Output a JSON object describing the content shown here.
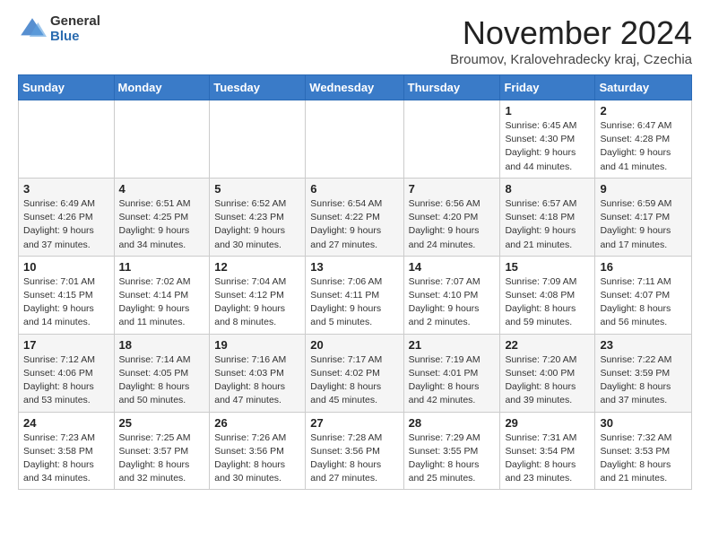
{
  "logo": {
    "general": "General",
    "blue": "Blue"
  },
  "title": "November 2024",
  "subtitle": "Broumov, Kralovehradecky kraj, Czechia",
  "days_header": [
    "Sunday",
    "Monday",
    "Tuesday",
    "Wednesday",
    "Thursday",
    "Friday",
    "Saturday"
  ],
  "weeks": [
    [
      {
        "day": "",
        "detail": ""
      },
      {
        "day": "",
        "detail": ""
      },
      {
        "day": "",
        "detail": ""
      },
      {
        "day": "",
        "detail": ""
      },
      {
        "day": "",
        "detail": ""
      },
      {
        "day": "1",
        "detail": "Sunrise: 6:45 AM\nSunset: 4:30 PM\nDaylight: 9 hours\nand 44 minutes."
      },
      {
        "day": "2",
        "detail": "Sunrise: 6:47 AM\nSunset: 4:28 PM\nDaylight: 9 hours\nand 41 minutes."
      }
    ],
    [
      {
        "day": "3",
        "detail": "Sunrise: 6:49 AM\nSunset: 4:26 PM\nDaylight: 9 hours\nand 37 minutes."
      },
      {
        "day": "4",
        "detail": "Sunrise: 6:51 AM\nSunset: 4:25 PM\nDaylight: 9 hours\nand 34 minutes."
      },
      {
        "day": "5",
        "detail": "Sunrise: 6:52 AM\nSunset: 4:23 PM\nDaylight: 9 hours\nand 30 minutes."
      },
      {
        "day": "6",
        "detail": "Sunrise: 6:54 AM\nSunset: 4:22 PM\nDaylight: 9 hours\nand 27 minutes."
      },
      {
        "day": "7",
        "detail": "Sunrise: 6:56 AM\nSunset: 4:20 PM\nDaylight: 9 hours\nand 24 minutes."
      },
      {
        "day": "8",
        "detail": "Sunrise: 6:57 AM\nSunset: 4:18 PM\nDaylight: 9 hours\nand 21 minutes."
      },
      {
        "day": "9",
        "detail": "Sunrise: 6:59 AM\nSunset: 4:17 PM\nDaylight: 9 hours\nand 17 minutes."
      }
    ],
    [
      {
        "day": "10",
        "detail": "Sunrise: 7:01 AM\nSunset: 4:15 PM\nDaylight: 9 hours\nand 14 minutes."
      },
      {
        "day": "11",
        "detail": "Sunrise: 7:02 AM\nSunset: 4:14 PM\nDaylight: 9 hours\nand 11 minutes."
      },
      {
        "day": "12",
        "detail": "Sunrise: 7:04 AM\nSunset: 4:12 PM\nDaylight: 9 hours\nand 8 minutes."
      },
      {
        "day": "13",
        "detail": "Sunrise: 7:06 AM\nSunset: 4:11 PM\nDaylight: 9 hours\nand 5 minutes."
      },
      {
        "day": "14",
        "detail": "Sunrise: 7:07 AM\nSunset: 4:10 PM\nDaylight: 9 hours\nand 2 minutes."
      },
      {
        "day": "15",
        "detail": "Sunrise: 7:09 AM\nSunset: 4:08 PM\nDaylight: 8 hours\nand 59 minutes."
      },
      {
        "day": "16",
        "detail": "Sunrise: 7:11 AM\nSunset: 4:07 PM\nDaylight: 8 hours\nand 56 minutes."
      }
    ],
    [
      {
        "day": "17",
        "detail": "Sunrise: 7:12 AM\nSunset: 4:06 PM\nDaylight: 8 hours\nand 53 minutes."
      },
      {
        "day": "18",
        "detail": "Sunrise: 7:14 AM\nSunset: 4:05 PM\nDaylight: 8 hours\nand 50 minutes."
      },
      {
        "day": "19",
        "detail": "Sunrise: 7:16 AM\nSunset: 4:03 PM\nDaylight: 8 hours\nand 47 minutes."
      },
      {
        "day": "20",
        "detail": "Sunrise: 7:17 AM\nSunset: 4:02 PM\nDaylight: 8 hours\nand 45 minutes."
      },
      {
        "day": "21",
        "detail": "Sunrise: 7:19 AM\nSunset: 4:01 PM\nDaylight: 8 hours\nand 42 minutes."
      },
      {
        "day": "22",
        "detail": "Sunrise: 7:20 AM\nSunset: 4:00 PM\nDaylight: 8 hours\nand 39 minutes."
      },
      {
        "day": "23",
        "detail": "Sunrise: 7:22 AM\nSunset: 3:59 PM\nDaylight: 8 hours\nand 37 minutes."
      }
    ],
    [
      {
        "day": "24",
        "detail": "Sunrise: 7:23 AM\nSunset: 3:58 PM\nDaylight: 8 hours\nand 34 minutes."
      },
      {
        "day": "25",
        "detail": "Sunrise: 7:25 AM\nSunset: 3:57 PM\nDaylight: 8 hours\nand 32 minutes."
      },
      {
        "day": "26",
        "detail": "Sunrise: 7:26 AM\nSunset: 3:56 PM\nDaylight: 8 hours\nand 30 minutes."
      },
      {
        "day": "27",
        "detail": "Sunrise: 7:28 AM\nSunset: 3:56 PM\nDaylight: 8 hours\nand 27 minutes."
      },
      {
        "day": "28",
        "detail": "Sunrise: 7:29 AM\nSunset: 3:55 PM\nDaylight: 8 hours\nand 25 minutes."
      },
      {
        "day": "29",
        "detail": "Sunrise: 7:31 AM\nSunset: 3:54 PM\nDaylight: 8 hours\nand 23 minutes."
      },
      {
        "day": "30",
        "detail": "Sunrise: 7:32 AM\nSunset: 3:53 PM\nDaylight: 8 hours\nand 21 minutes."
      }
    ]
  ]
}
